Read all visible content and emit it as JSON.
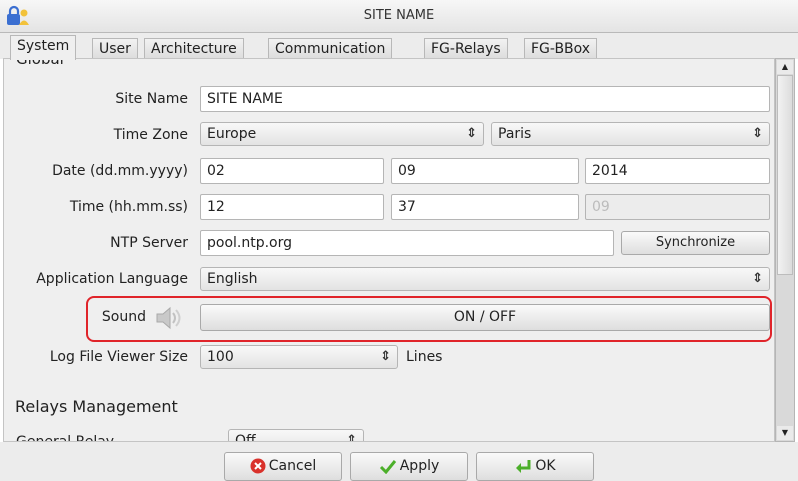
{
  "window": {
    "title": "SITE NAME",
    "icon": "lock-person-icon"
  },
  "tabs": [
    {
      "label": "System",
      "active": true
    },
    {
      "label": "User"
    },
    {
      "label": "Architecture"
    },
    {
      "label": "Communication"
    },
    {
      "label": "FG-Relays"
    },
    {
      "label": "FG-BBox"
    }
  ],
  "system": {
    "section_global": "Global",
    "site_name": {
      "label": "Site Name",
      "value": "SITE NAME"
    },
    "time_zone": {
      "label": "Time Zone",
      "region": "Europe",
      "city": "Paris"
    },
    "date": {
      "label": "Date (dd.mm.yyyy)",
      "day": "02",
      "month": "09",
      "year": "2014"
    },
    "time": {
      "label": "Time (hh.mm.ss)",
      "hours": "12",
      "minutes": "37",
      "seconds": "09"
    },
    "ntp": {
      "label": "NTP Server",
      "value": "pool.ntp.org",
      "sync_label": "Synchronize"
    },
    "language": {
      "label": "Application Language",
      "value": "English"
    },
    "sound": {
      "label": "Sound",
      "icon": "speaker-icon",
      "toggle_label": "ON / OFF"
    },
    "log_viewer": {
      "label": "Log File Viewer Size",
      "value": "100",
      "unit": "Lines"
    },
    "relays": {
      "heading": "Relays Management",
      "general_label": "General Relay",
      "general_value": "Off"
    }
  },
  "buttons": {
    "cancel": {
      "label": "Cancel",
      "icon": "cancel-x-icon"
    },
    "apply": {
      "label": "Apply",
      "icon": "checkmark-icon"
    },
    "ok": {
      "label": "OK",
      "icon": "ok-arrow-icon"
    }
  },
  "colors": {
    "highlight": "#e0242a",
    "cancel_icon": "#d9312b",
    "check_icon": "#4caf2a"
  }
}
